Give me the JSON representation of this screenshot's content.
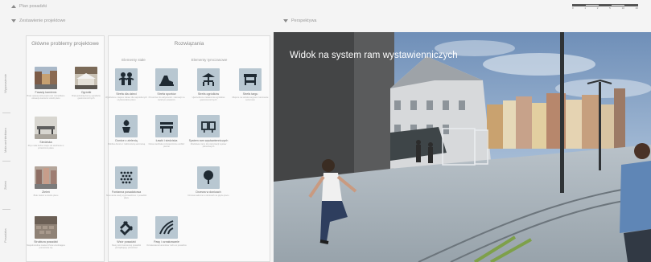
{
  "topbar": {
    "collapse_label": "Plan posadzki"
  },
  "scale_bar": {
    "labels": [
      "0",
      "1",
      "2",
      "5",
      "10",
      "20"
    ]
  },
  "left_header": {
    "label": "Zestawienie projektowe"
  },
  "right_header": {
    "label": "Perspektywa"
  },
  "categories": [
    "Wyposażenie",
    "Mała architektura",
    "Zieleń",
    "Posadzka"
  ],
  "problems": {
    "title": "Główne problemy projektowe",
    "items": [
      {
        "title": "Fasady kamienic",
        "desc": "Brak spójnej kolorystyki oraz zaniedbane elewacje kamienic wokół placu"
      },
      {
        "title": "Ogródki",
        "desc": "Brak jednolitej formy ogródków gastronomicznych"
      },
      {
        "title": "Siedziska",
        "desc": "Zbyt mała liczba miejsc do siedzenia w przestrzeni placu"
      },
      {
        "title": "Zieleń",
        "desc": "Brak zieleni w strefie placu"
      },
      {
        "title": "Struktura posadzki",
        "desc": "Niejednorodna nawierzchnia utrudniająca poruszanie się"
      }
    ]
  },
  "solutions": {
    "title": "Rozwiązania",
    "group_a": "Elementy stałe",
    "group_b": "Elementy tymczasowe",
    "items": [
      {
        "title": "Strefa dla dzieci",
        "desc": "Wydzielone miejsce zabaw dla najmłodszych użytkowników placu"
      },
      {
        "title": "Strefa sportów",
        "desc": "Przestrzeń do aktywności i rekreacji na świeżym powietrzu"
      },
      {
        "title": "Strefa ogródków",
        "desc": "Ujednolicone zadaszenia ogródków gastronomicznych"
      },
      {
        "title": "Strefa targu",
        "desc": "Miejsce na stoiska targowe i kiermasze sezonowe"
      },
      {
        "title": "Donice z zielenią",
        "desc": "Mobilne donice z roślinnością sezonową"
      },
      {
        "title": "Ławki i siedziska",
        "desc": "Nowe siedziska rozmieszczone wzdłuż pierzei"
      },
      {
        "title": "System ram wystawienniczych",
        "desc": "Modułowe ramy do prezentacji wystaw plenerowych"
      },
      {
        "title": "Fontanna posadzkowa",
        "desc": "Strumienie wody wyprowadzone z posadzki placu"
      },
      {
        "title": "Drzewa w donicach",
        "desc": "Drzewa sadzone w donicach na płycie placu"
      },
      {
        "title": "Wzór posadzki",
        "desc": "Nowy wzór kamiennej posadzki porządkujący przestrzeń"
      },
      {
        "title": "Pasy i oznakowanie",
        "desc": "Oznakowanie kierunków ruchu w posadzce"
      }
    ]
  },
  "perspective": {
    "title": "Widok na system ram wystawienniczych"
  },
  "colors": {
    "icon_tile": "#b8c7d1",
    "icon_glyph": "#1f2a33",
    "background": "#f4f4f4",
    "sky": "#9bb3cf"
  }
}
